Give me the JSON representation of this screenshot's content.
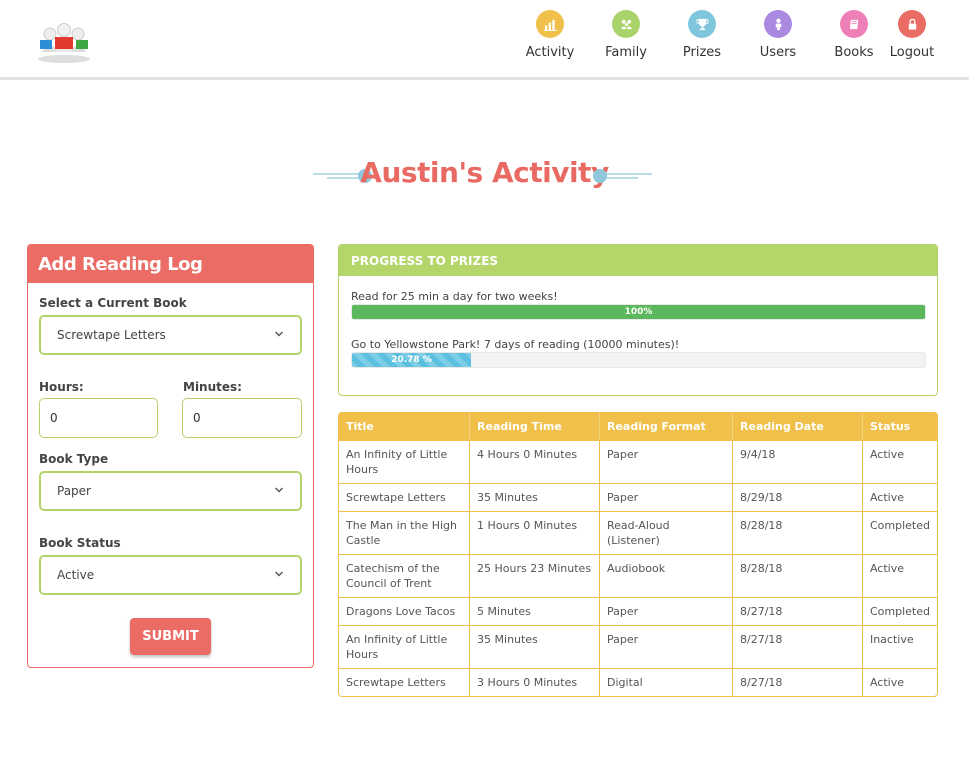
{
  "header": {
    "nav": [
      {
        "label": "Activity",
        "icon": "bar-chart-icon",
        "color": "#f0c04a"
      },
      {
        "label": "Family",
        "icon": "family-icon",
        "color": "#a8d26a"
      },
      {
        "label": "Prizes",
        "icon": "trophy-icon",
        "color": "#7fc6dc"
      },
      {
        "label": "Users",
        "icon": "user-icon",
        "color": "#a98ae0"
      },
      {
        "label": "Books",
        "icon": "book-icon",
        "color": "#ef7fb7"
      },
      {
        "label": "Logout",
        "icon": "lock-icon",
        "color": "#ea6c64"
      }
    ]
  },
  "page": {
    "title": "Austin's Activity"
  },
  "log_form": {
    "heading": "Add Reading Log",
    "book_label": "Select a Current Book",
    "book_value": "Screwtape Letters",
    "hours_label": "Hours:",
    "hours_value": "0",
    "minutes_label": "Minutes:",
    "minutes_value": "0",
    "type_label": "Book Type",
    "type_value": "Paper",
    "status_label": "Book Status",
    "status_value": "Active",
    "submit_label": "SUBMIT"
  },
  "progress": {
    "heading": "PROGRESS TO PRIZES",
    "goals": [
      {
        "text": "Read for 25 min a day for two weeks!",
        "percent": 100,
        "label": "100%"
      },
      {
        "text": "Go to Yellowstone Park! 7 days of reading (10000 minutes)!",
        "percent": 20.78,
        "label": "20.78 %"
      }
    ]
  },
  "table": {
    "columns": [
      "Title",
      "Reading Time",
      "Reading Format",
      "Reading Date",
      "Status"
    ],
    "rows": [
      [
        "An Infinity of Little Hours",
        "4 Hours 0 Minutes",
        "Paper",
        "9/4/18",
        "Active"
      ],
      [
        "Screwtape Letters",
        "35 Minutes",
        "Paper",
        "8/29/18",
        "Active"
      ],
      [
        "The Man in the High Castle",
        "1 Hours 0 Minutes",
        "Read-Aloud (Listener)",
        "8/28/18",
        "Completed"
      ],
      [
        "Catechism of the Council of Trent",
        "25 Hours 23 Minutes",
        "Audiobook",
        "8/28/18",
        "Active"
      ],
      [
        "Dragons Love Tacos",
        "5 Minutes",
        "Paper",
        "8/27/18",
        "Completed"
      ],
      [
        "An Infinity of Little Hours",
        "35 Minutes",
        "Paper",
        "8/27/18",
        "Inactive"
      ],
      [
        "Screwtape Letters",
        "3 Hours 0 Minutes",
        "Digital",
        "8/27/18",
        "Active"
      ]
    ]
  },
  "colors": {
    "accent_red": "#ea6c64",
    "accent_green": "#b3d56a",
    "accent_yellow": "#f0c04a",
    "accent_blue": "#7fc6dc"
  }
}
